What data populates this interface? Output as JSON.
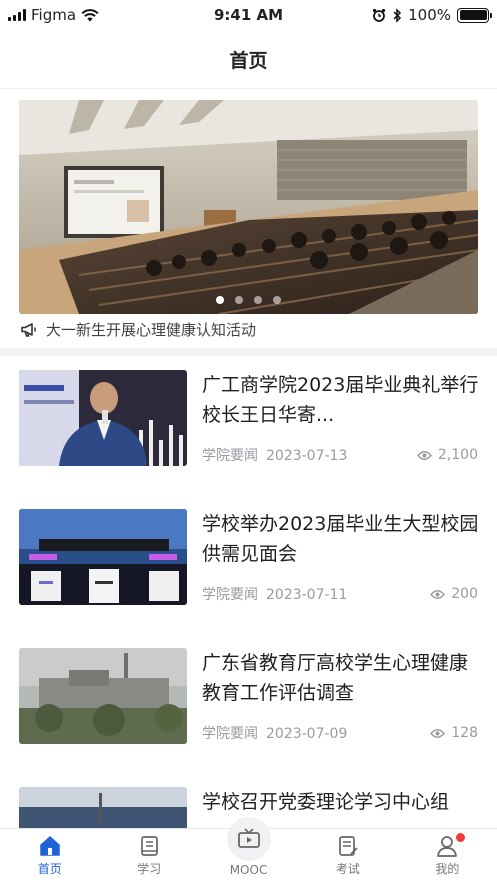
{
  "status_bar": {
    "carrier": "Figma",
    "time": "9:41 AM",
    "battery": "100%"
  },
  "header": {
    "title": "首页"
  },
  "banner": {
    "dot_count": 4,
    "active_index": 0
  },
  "notice": {
    "text": "大一新生开展心理健康认知活动",
    "icon": "megaphone-icon"
  },
  "news": [
    {
      "title": "广工商学院2023届毕业典礼举行校长王日华寄...",
      "source": "学院要闻",
      "date": "2023-07-13",
      "views": "2,100"
    },
    {
      "title": "学校举办2023届毕业生大型校园供需见面会",
      "source": "学院要闻",
      "date": "2023-07-11",
      "views": "200"
    },
    {
      "title": "广东省教育厅高校学生心理健康教育工作评估调查",
      "source": "学院要闻",
      "date": "2023-07-09",
      "views": "128"
    },
    {
      "title": "学校召开党委理论学习中心组",
      "source": "",
      "date": "",
      "views": ""
    }
  ],
  "tabs": [
    {
      "label": "首页",
      "icon": "home-icon",
      "active": true
    },
    {
      "label": "学习",
      "icon": "book-icon",
      "active": false
    },
    {
      "label": "MOOC",
      "icon": "tv-icon",
      "active": false
    },
    {
      "label": "考试",
      "icon": "exam-icon",
      "active": false
    },
    {
      "label": "我的",
      "icon": "user-icon",
      "active": false,
      "badge": true
    }
  ],
  "colors": {
    "accent": "#1e63d6",
    "badge": "#ef3b3b",
    "meta": "#9a9aa0"
  }
}
